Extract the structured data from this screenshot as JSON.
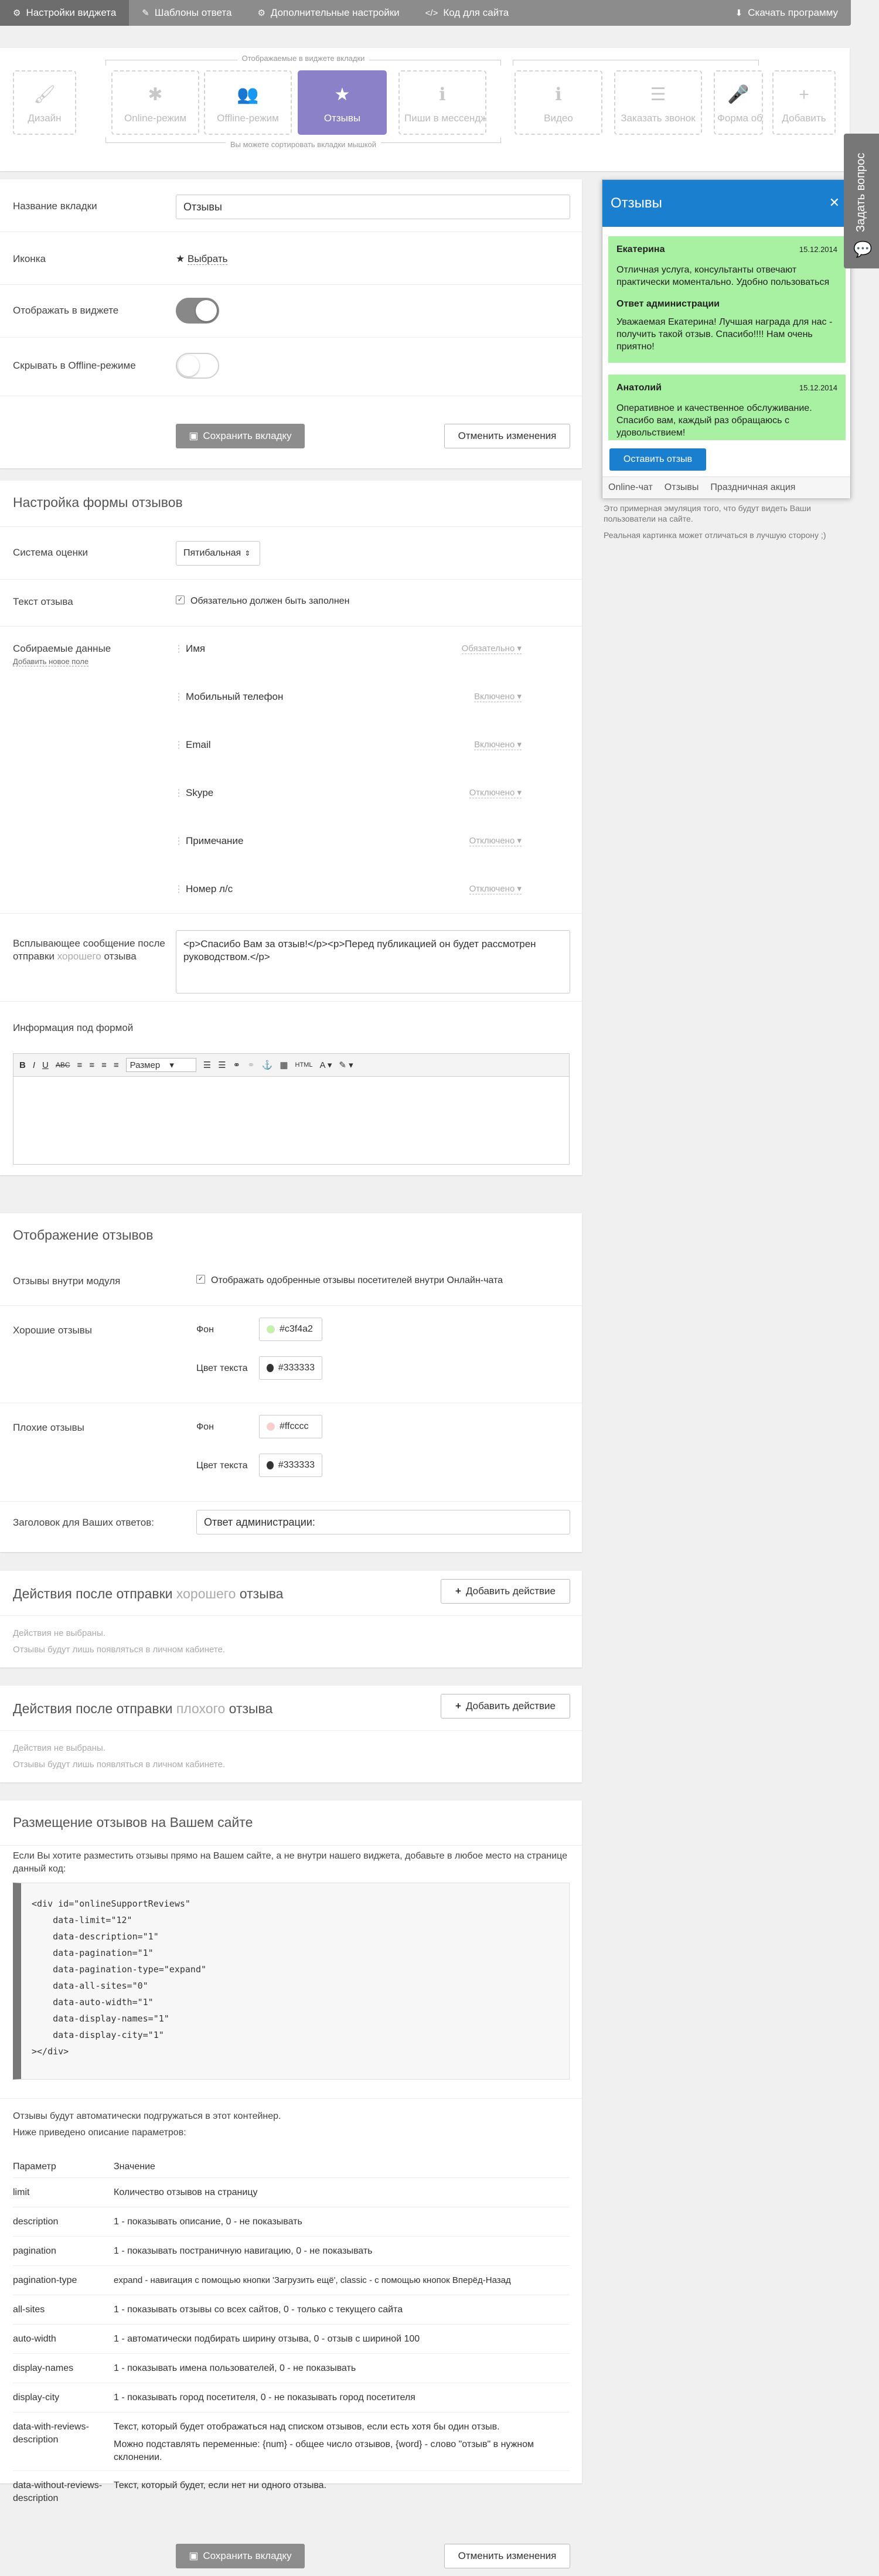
{
  "topbar": {
    "items": [
      {
        "icon": "⚙",
        "label": "Настройки виджета"
      },
      {
        "icon": "✎",
        "label": "Шаблоны ответа"
      },
      {
        "icon": "⚙",
        "label": "Дополнительные настройки"
      },
      {
        "icon": "</>",
        "label": "Код для сайта"
      }
    ],
    "download": {
      "icon": "⬇",
      "label": "Скачать программу"
    }
  },
  "tabs": {
    "top_caption": "Отображаемые в виджете вкладки",
    "bottom_caption": "Вы можете сортировать вкладки мышкой",
    "tiles": [
      {
        "icon": "🖌",
        "label": "Дизайн"
      },
      {
        "icon": "✱",
        "label": "Online-режим"
      },
      {
        "icon": "👥",
        "label": "Offline-режим"
      },
      {
        "icon": "★",
        "label": "Отзывы"
      },
      {
        "icon": "ℹ",
        "label": "Пиши в мессенджер"
      },
      {
        "icon": "ℹ",
        "label": "Видео"
      },
      {
        "icon": "☰",
        "label": "Заказать звонок"
      },
      {
        "icon": "🎤",
        "label": "Форма обратной связи"
      },
      {
        "icon": "+",
        "label": "Добавить"
      }
    ]
  },
  "settings": {
    "tab_name_label": "Название вкладки",
    "tab_name_value": "Отзывы",
    "icon_label": "Иконка",
    "icon_symbol": "★",
    "icon_choose": "Выбрать",
    "show_label": "Отображать в виджете",
    "hide_offline_label": "Скрывать в Offline-режиме",
    "save": "Сохранить вкладку",
    "cancel": "Отменить изменения"
  },
  "form": {
    "title": "Настройка формы отзывов",
    "rating_label": "Система оценки",
    "rating_value": "Пятибальная",
    "text_label": "Текст отзыва",
    "text_required": "Обязательно должен быть заполнен",
    "collected_label": "Собираемые данные",
    "add_field": "Добавить новое поле",
    "fields": [
      {
        "name": "Имя",
        "state": "Обязательно"
      },
      {
        "name": "Мобильный телефон",
        "state": "Включено"
      },
      {
        "name": "Email",
        "state": "Включено"
      },
      {
        "name": "Skype",
        "state": "Отключено"
      },
      {
        "name": "Примечание",
        "state": "Отключено"
      },
      {
        "name": "Номер л/с",
        "state": "Отключено"
      }
    ],
    "popup_label_1": "Всплывающее сообщение после отправки",
    "popup_label_good": "хорошего",
    "popup_label_2": "отзыва",
    "popup_value": "<p>Спасибо Вам за отзыв!</p><p>Перед публикацией он будет рассмотрен руководством.</p>",
    "info_label": "Информация под формой",
    "rte_size": "Размер"
  },
  "display": {
    "title": "Отображение отзывов",
    "inside_label": "Отзывы внутри модуля",
    "inside_value": "Отображать одобренные отзывы посетителей внутри Онлайн-чата",
    "good_label": "Хорошие отзывы",
    "bad_label": "Плохие отзывы",
    "bg_label": "Фон",
    "text_color_label": "Цвет текста",
    "good_bg": "#c3f4a2",
    "good_text": "#333333",
    "bad_bg": "#ffcccc",
    "bad_text": "#333333",
    "reply_label": "Заголовок для Ваших ответов:",
    "reply_value": "Ответ администрации:"
  },
  "actions_good": {
    "title_1": "Действия после отправки",
    "title_mid": "хорошего",
    "title_2": "отзыва",
    "button": "Добавить действие",
    "none": "Действия не выбраны.",
    "note": "Отзывы будут лишь появляться в личном кабинете."
  },
  "actions_bad": {
    "title_1": "Действия после отправки",
    "title_mid": "плохого",
    "title_2": "отзыва",
    "button": "Добавить действие",
    "none": "Действия не выбраны.",
    "note": "Отзывы будут лишь появляться в личном кабинете."
  },
  "placement": {
    "title": "Размещение отзывов на Вашем сайте",
    "intro": "Если Вы хотите разместить отзывы прямо на Вашем сайте, а не внутри нашего виджета, добавьте в любое место на странице данный код:",
    "code": [
      "<div id=\"onlineSupportReviews\"",
      "    data-limit=\"12\"",
      "    data-description=\"1\"",
      "    data-pagination=\"1\"",
      "    data-pagination-type=\"expand\"",
      "    data-all-sites=\"0\"",
      "    data-auto-width=\"1\"",
      "    data-display-names=\"1\"",
      "    data-display-city=\"1\"",
      "></div>"
    ],
    "auto_note": "Отзывы будут автоматически подгружаться в этот контейнер.",
    "desc_note": "Ниже приведено описание параметров:",
    "col_param": "Параметр",
    "col_value": "Значение",
    "params": [
      {
        "k": "limit",
        "v": "Количество отзывов на страницу"
      },
      {
        "k": "description",
        "v": "1 - показывать описание, 0 - не показывать"
      },
      {
        "k": "pagination",
        "v": "1 - показывать постраничную навигацию, 0 - не показывать"
      },
      {
        "k": "pagination-type",
        "v": "expand - навигация с помощью кнопки 'Загрузить ещё', classic - с помощью кнопок Вперёд-Назад"
      },
      {
        "k": "all-sites",
        "v": "1 - показывать отзывы со всех сайтов, 0 - только с текущего сайта"
      },
      {
        "k": "auto-width",
        "v": "1 - автоматически подбирать ширину отзыва, 0 - отзыв с шириной 100"
      },
      {
        "k": "display-names",
        "v": "1 - показывать имена пользователей, 0 - не показывать"
      },
      {
        "k": "display-city",
        "v": "1 - показывать город посетителя, 0 - не показывать город посетителя"
      },
      {
        "k": "data-with-reviews-description",
        "v": "Текст, который будет отображаться над списком отзывов, если есть хотя бы один отзыв.",
        "v2": "Можно подставлять переменные: {num} - общее число отзывов, {word} - слово \"отзыв\" в нужном склонении."
      },
      {
        "k": "data-without-reviews-description",
        "v": "Текст, который будет, если нет ни одного отзыва."
      }
    ]
  },
  "footer": {
    "save": "Сохранить вкладку",
    "cancel": "Отменить изменения"
  },
  "preview": {
    "title": "Отзывы",
    "reviews": [
      {
        "name": "Екатерина",
        "date": "15.12.2014",
        "text": "Отличная услуга, консультанты отвечают практически моментально. Удобно пользоваться",
        "reply_title": "Ответ администрации",
        "reply": "Уважаемая Екатерина! Лучшая награда для нас - получить такой отзыв. Спасибо!!!! Нам очень приятно!"
      },
      {
        "name": "Анатолий",
        "date": "15.12.2014",
        "text": "Оперативное и качественное обслуживание. Спасибо вам, каждый раз обращаюсь с удовольствием!"
      }
    ],
    "button": "Оставить отзыв",
    "tabs": [
      "Online-чат",
      "Отзывы",
      "Праздничная акция"
    ],
    "note1": "Это примерная эмуляция того, что будут видеть Ваши пользователи на сайте.",
    "note2": "Реальная картинка может отличаться в лучшую сторону ;)"
  },
  "side_tab": {
    "label": "Задать вопрос"
  }
}
